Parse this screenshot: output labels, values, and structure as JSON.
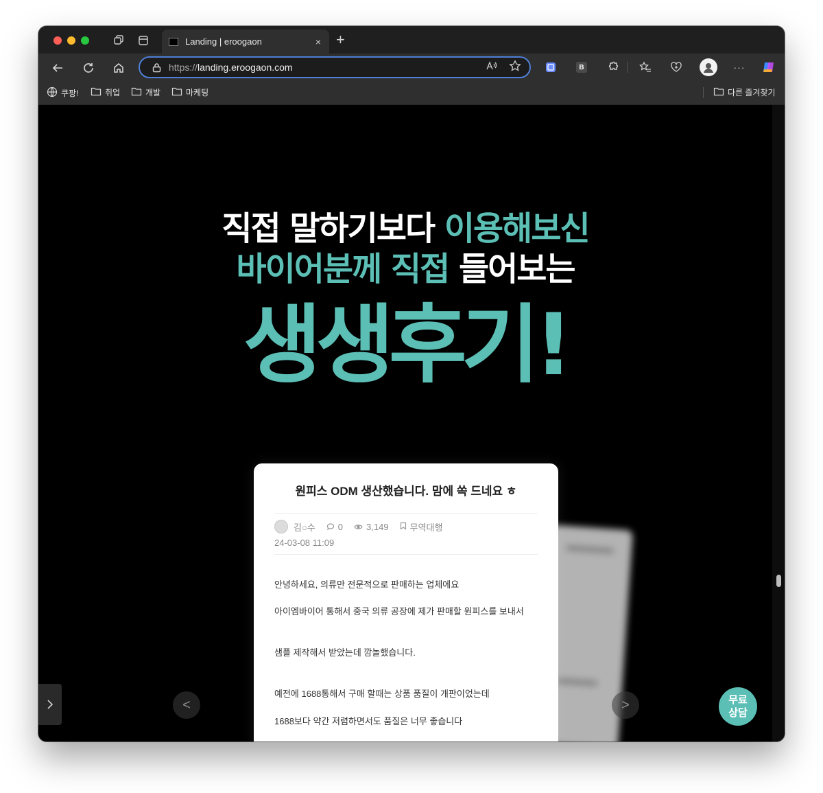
{
  "browser": {
    "tab": {
      "title": "Landing | eroogaon",
      "close": "×"
    },
    "new_tab": "+",
    "address": {
      "scheme": "https://",
      "domain": "landing.eroogaon.com"
    },
    "extension_b_label": "B",
    "more_label": "···"
  },
  "bookmarks": {
    "items": [
      {
        "label": "쿠팡!",
        "icon": "globe-icon"
      },
      {
        "label": "취업",
        "icon": "folder-icon"
      },
      {
        "label": "개발",
        "icon": "folder-icon"
      },
      {
        "label": "마케팅",
        "icon": "folder-icon"
      }
    ],
    "other": "다른 즐겨찾기"
  },
  "page": {
    "headline": {
      "line1_white": "직접 말하기보다 ",
      "line1_teal": "이용해보신",
      "line2_teal": "바이어분께 직접 ",
      "line2_white": "들어보는",
      "line3": "생생후기!"
    },
    "review": {
      "title": "원피스 ODM 생산했습니다. 맘에 쏙 드네요 ㅎ",
      "author": "김○수",
      "comments": "0",
      "views": "3,149",
      "category": "무역대행",
      "date": "24-03-08 11:09",
      "paragraphs": [
        "안녕하세요, 의류만 전문적으로 판매하는 업체에요",
        "아이엠바이어 통해서 중국 의류 공장에 제가 판매할 원피스를 보내서",
        "샘플 제작해서 받았는데 깜놀했습니다.",
        "예전에 1688통해서 구매 할때는 상품 품질이 개판이었는데",
        "1688보다 약간 저렴하면서도 품질은 너무 좋습니다"
      ]
    },
    "carousel": {
      "prev": "<",
      "next": ">"
    },
    "consult": {
      "line1": "무료",
      "line2": "상담"
    }
  },
  "colors": {
    "accent_teal": "#5cbfb5",
    "address_focus": "#4f7fd6",
    "page_bg": "#000000"
  }
}
